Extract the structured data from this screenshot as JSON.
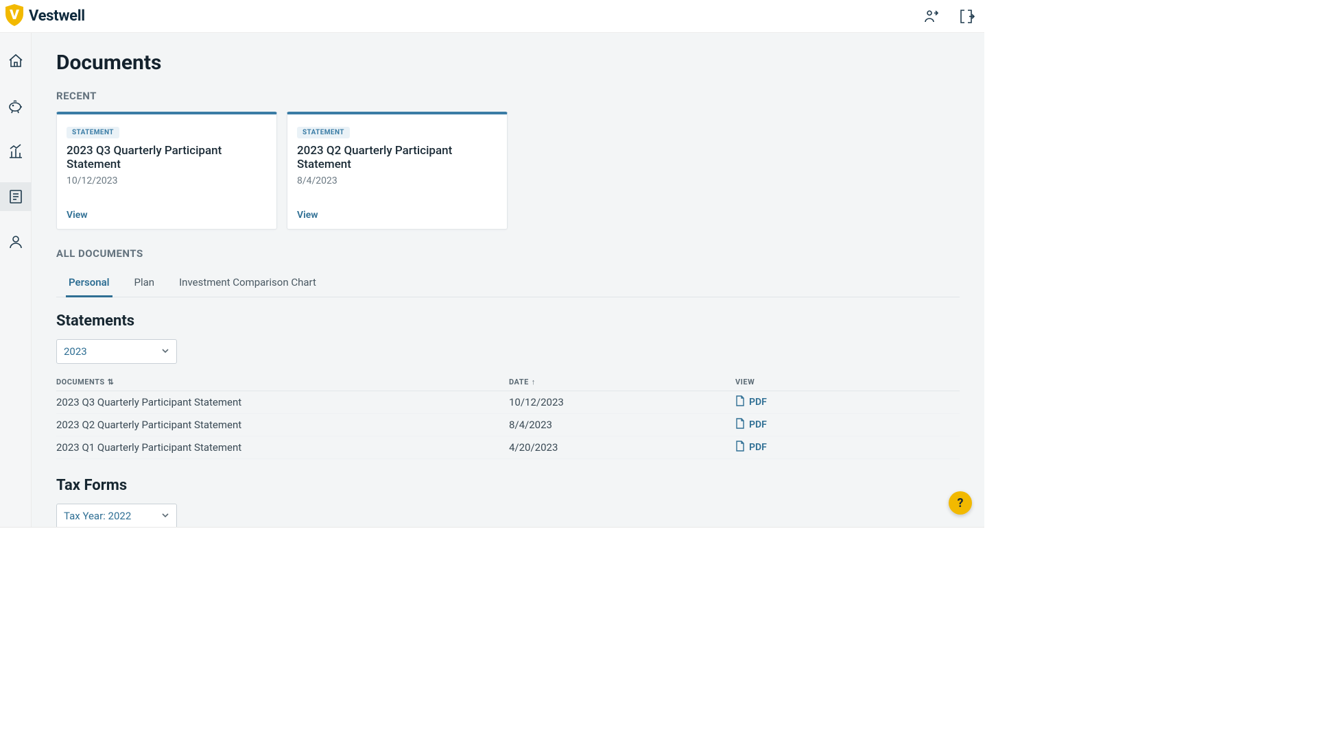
{
  "brand": {
    "name": "Vestwell"
  },
  "page": {
    "title": "Documents"
  },
  "sections": {
    "recent_label": "RECENT",
    "all_documents_label": "ALL DOCUMENTS"
  },
  "recent": [
    {
      "badge": "STATEMENT",
      "title": "2023 Q3 Quarterly Participant Statement",
      "date": "10/12/2023",
      "view_label": "View"
    },
    {
      "badge": "STATEMENT",
      "title": "2023 Q2 Quarterly Participant Statement",
      "date": "8/4/2023",
      "view_label": "View"
    }
  ],
  "tabs": {
    "personal": "Personal",
    "plan": "Plan",
    "investment_chart": "Investment Comparison Chart"
  },
  "statements": {
    "heading": "Statements",
    "year_selected": "2023",
    "columns": {
      "documents": "DOCUMENTS",
      "date": "DATE",
      "view": "VIEW"
    },
    "pdf_label": "PDF",
    "rows": [
      {
        "doc": "2023 Q3 Quarterly Participant Statement",
        "date": "10/12/2023"
      },
      {
        "doc": "2023 Q2 Quarterly Participant Statement",
        "date": "8/4/2023"
      },
      {
        "doc": "2023 Q1 Quarterly Participant Statement",
        "date": "4/20/2023"
      }
    ]
  },
  "tax_forms": {
    "heading": "Tax Forms",
    "year_selected": "Tax Year: 2022"
  },
  "help": {
    "label": "?"
  }
}
